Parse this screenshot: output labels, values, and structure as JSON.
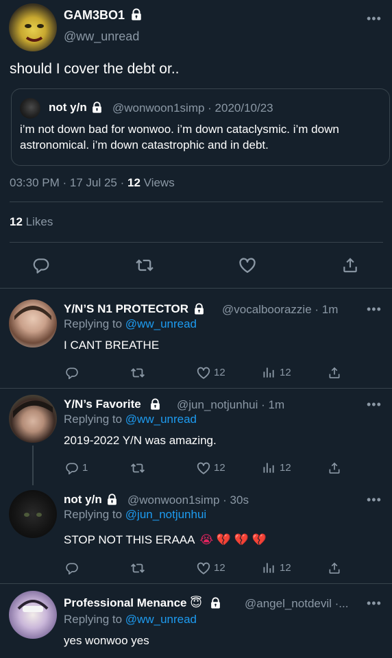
{
  "main": {
    "author_name": "GAM3BO1",
    "author_handle": "@ww_unread",
    "text": "should I cover the debt or..",
    "quote": {
      "name": "not y/n",
      "handle": "@wonwoon1simp",
      "date": "· 2020/10/23",
      "text": "i’m not down bad for wonwoo. i’m down cataclysmic. i’m down astronomical. i’m down catastrophic and in debt."
    },
    "timestamp": "03:30 PM · 17 Jul 25 ·",
    "views_count": "12",
    "views_label": "Views",
    "likes_count": "12",
    "likes_label": "Likes"
  },
  "replies": [
    {
      "name": "Y/N’S N1 PROTECTOR",
      "handle": "@vocalboorazzie · 1m",
      "replying_prefix": "Replying to",
      "replying_to": "@ww_unread",
      "text": "I CANT BREATHE",
      "reply_count": "",
      "like_count": "12",
      "view_count": "12"
    },
    {
      "name": "Y/N’s Favorite",
      "handle": "@jun_notjunhui · 1m",
      "replying_prefix": "Replying to",
      "replying_to": "@ww_unread",
      "text": "2019-2022 Y/N was amazing.",
      "reply_count": "1",
      "like_count": "12",
      "view_count": "12"
    },
    {
      "name": "not y/n",
      "handle": "@wonwoon1simp · 30s",
      "replying_prefix": "Replying to",
      "replying_to": "@jun_notjunhui",
      "text": "STOP NOT THIS ERAAA",
      "emojis": "😭 💔 💔 💔",
      "reply_count": "",
      "like_count": "12",
      "view_count": "12"
    },
    {
      "name": "Professional Menance",
      "name_emoji": "😇",
      "handle": "@angel_notdevil ·...",
      "replying_prefix": "Replying to",
      "replying_to": "@ww_unread",
      "text": "yes wonwoo yes"
    }
  ],
  "icons": {
    "more": "more-dots-icon",
    "reply": "reply-bubble-icon",
    "retweet": "retweet-icon",
    "like": "heart-icon",
    "share": "share-icon",
    "views": "views-bar-icon",
    "lock": "lock-icon"
  },
  "colors": {
    "background": "#15202b",
    "muted": "#8b98a5",
    "link": "#1d9bf0",
    "divider": "#38444d",
    "heart_emoji": "#e0245e"
  }
}
